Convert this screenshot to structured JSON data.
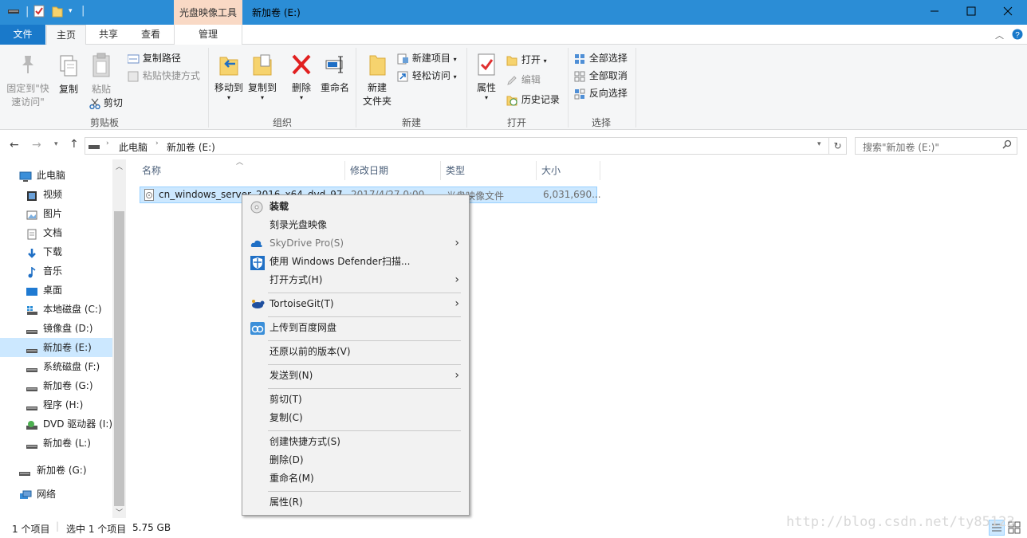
{
  "window": {
    "contextual_tab_group": "光盘映像工具",
    "title": "新加卷 (E:)"
  },
  "ribbon_tabs": {
    "file": "文件",
    "home": "主页",
    "share": "共享",
    "view": "查看",
    "manage": "管理"
  },
  "ribbon": {
    "clipboard": {
      "pin": "固定到\"快速访问\"",
      "copy": "复制",
      "paste": "粘贴",
      "copy_path": "复制路径",
      "paste_shortcut": "粘贴快捷方式",
      "cut": "剪切",
      "label": "剪贴板"
    },
    "organize": {
      "move_to": "移动到",
      "copy_to": "复制到",
      "delete": "删除",
      "rename": "重命名",
      "label": "组织"
    },
    "new": {
      "new_folder": "新建\n文件夹",
      "new_item": "新建项目",
      "easy_access": "轻松访问",
      "label": "新建"
    },
    "open": {
      "properties": "属性",
      "open": "打开",
      "edit": "编辑",
      "history": "历史记录",
      "label": "打开"
    },
    "select": {
      "select_all": "全部选择",
      "select_none": "全部取消",
      "invert": "反向选择",
      "label": "选择"
    }
  },
  "address": {
    "crumbs": [
      "此电脑",
      "新加卷 (E:)"
    ],
    "search_placeholder": "搜索\"新加卷 (E:)\""
  },
  "nav": {
    "items": [
      {
        "label": "此电脑",
        "icon": "computer-icon"
      },
      {
        "label": "视频",
        "icon": "video-folder-icon"
      },
      {
        "label": "图片",
        "icon": "pictures-folder-icon"
      },
      {
        "label": "文档",
        "icon": "documents-folder-icon"
      },
      {
        "label": "下载",
        "icon": "download-icon"
      },
      {
        "label": "音乐",
        "icon": "music-icon"
      },
      {
        "label": "桌面",
        "icon": "desktop-icon"
      },
      {
        "label": "本地磁盘 (C:)",
        "icon": "windows-drive-icon"
      },
      {
        "label": "镜像盘 (D:)",
        "icon": "drive-icon"
      },
      {
        "label": "新加卷 (E:)",
        "icon": "drive-icon"
      },
      {
        "label": "系统磁盘 (F:)",
        "icon": "drive-icon"
      },
      {
        "label": "新加卷 (G:)",
        "icon": "drive-icon"
      },
      {
        "label": "程序 (H:)",
        "icon": "drive-icon"
      },
      {
        "label": "DVD 驱动器 (I:)",
        "icon": "dvd-drive-icon"
      },
      {
        "label": "新加卷 (L:)",
        "icon": "drive-icon"
      },
      {
        "label": "新加卷 (G:)",
        "icon": "drive-icon"
      },
      {
        "label": "网络",
        "icon": "network-icon"
      }
    ],
    "selected_index": 9
  },
  "columns": {
    "name": "名称",
    "modified": "修改日期",
    "type": "类型",
    "size": "大小"
  },
  "file": {
    "name": "cn_windows_server_2016_x64_dvd_97",
    "modified": "2017/4/27 0:00",
    "type": "光盘映像文件",
    "size": "6,031,690..."
  },
  "context_menu": {
    "mount": "装载",
    "burn": "刻录光盘映像",
    "skydrive": "SkyDrive Pro(S)",
    "defender": "使用 Windows Defender扫描...",
    "open_with": "打开方式(H)",
    "tortoisegit": "TortoiseGit(T)",
    "baidu": "上传到百度网盘",
    "restore": "还原以前的版本(V)",
    "send_to": "发送到(N)",
    "cut": "剪切(T)",
    "copy": "复制(C)",
    "shortcut": "创建快捷方式(S)",
    "delete": "删除(D)",
    "rename": "重命名(M)",
    "properties": "属性(R)"
  },
  "status": {
    "count": "1 个项目",
    "selected": "选中 1 个项目",
    "size": "5.75 GB"
  },
  "watermark": "http://blog.csdn.net/ty85123",
  "colors": {
    "title_bar": "#2b8dd6",
    "file_tab": "#1979ca",
    "contextual_tab": "#f9d9c5",
    "selection": "#cce8ff"
  }
}
